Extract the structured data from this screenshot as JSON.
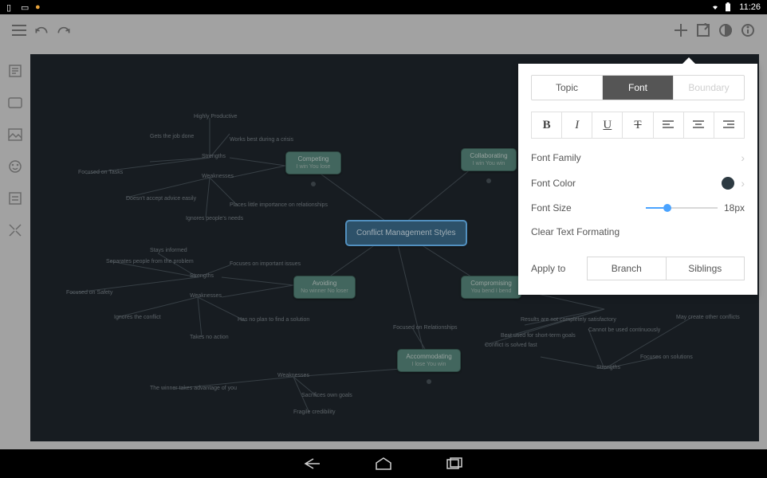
{
  "statusbar": {
    "time": "11:26"
  },
  "panel": {
    "tabs": {
      "topic": "Topic",
      "font": "Font",
      "boundary": "Boundary"
    },
    "format": {
      "bold": "B",
      "italic": "I",
      "underline": "U",
      "strike": "T"
    },
    "rows": {
      "family": "Font Family",
      "color": "Font Color",
      "size": "Font Size",
      "sizeValue": "18px",
      "clear": "Clear Text Formating"
    },
    "apply": {
      "label": "Apply to",
      "branch": "Branch",
      "siblings": "Siblings"
    }
  },
  "mindmap": {
    "central": "Conflict Management Styles",
    "topGroup": {
      "strengths": "Strengths",
      "weaknesses": "Weaknesses",
      "s1": "Highly Productive",
      "s2": "Gets the job done",
      "s3": "Works best during a crisis",
      "s4": "Focused on Tasks",
      "w1": "Doesn't accept advice easily",
      "w2": "Places little importance on relationships",
      "w3": "Ignores people's needs"
    },
    "competing": {
      "title": "Competing",
      "sub": "I win You lose"
    },
    "collaborating": {
      "title": "Collaborating",
      "sub": "I win You win"
    },
    "avoiding": {
      "title": "Avoiding",
      "sub": "No winner No loser"
    },
    "compromising": {
      "title": "Compromising",
      "sub": "You bend I bend"
    },
    "accommodating": {
      "title": "Accommodating",
      "sub": "I lose You win"
    },
    "midGroup": {
      "strengths": "Strengths",
      "weaknesses": "Weaknesses",
      "s1": "Stays informed",
      "s2": "Separates people from the problem",
      "s3": "Focuses on important issues",
      "s4": "Focused on Safety",
      "w1": "Ignores the conflict",
      "w2": "Has no plan to find a solution",
      "w3": "Takes no action"
    },
    "bottomGroup": {
      "weaknesses": "Weaknesses",
      "w1": "The winner takes advantage of you",
      "w2": "Sacrifices own goals",
      "w3": "Fragile credibility",
      "rel": "Focused on Relationships"
    },
    "rightGroup": {
      "strengths": "Strengths",
      "r1": "Results are not completely satisfactory",
      "r2": "Best used for short-term goals",
      "r3": "Conflict is solved fast",
      "r4": "Cannot be used continuously",
      "r5": "May create other conflicts",
      "r6": "Focuses on solutions"
    }
  }
}
